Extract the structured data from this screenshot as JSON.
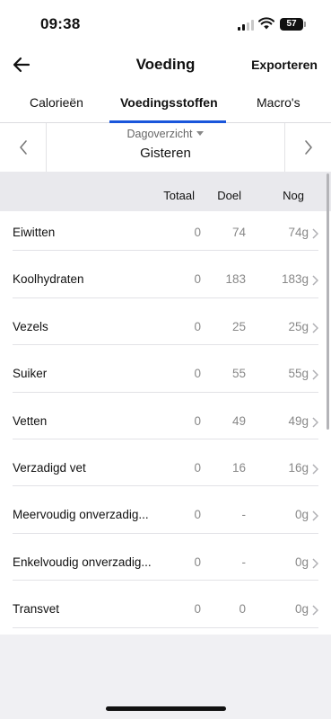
{
  "status_bar": {
    "time": "09:38",
    "battery": "57"
  },
  "nav": {
    "title": "Voeding",
    "export_label": "Exporteren"
  },
  "tabs": [
    {
      "label": "Calorieën"
    },
    {
      "label": "Voedingsstoffen"
    },
    {
      "label": "Macro's"
    }
  ],
  "day_nav": {
    "label": "Dagoverzicht",
    "value": "Gisteren"
  },
  "table": {
    "headers": [
      "Totaal",
      "Doel",
      "Nog"
    ],
    "rows": [
      {
        "name": "Eiwitten",
        "totaal": "0",
        "doel": "74",
        "nog": "74g"
      },
      {
        "name": "Koolhydraten",
        "totaal": "0",
        "doel": "183",
        "nog": "183g"
      },
      {
        "name": "Vezels",
        "totaal": "0",
        "doel": "25",
        "nog": "25g"
      },
      {
        "name": "Suiker",
        "totaal": "0",
        "doel": "55",
        "nog": "55g"
      },
      {
        "name": "Vetten",
        "totaal": "0",
        "doel": "49",
        "nog": "49g"
      },
      {
        "name": "Verzadigd vet",
        "totaal": "0",
        "doel": "16",
        "nog": "16g"
      },
      {
        "name": "Meervoudig onverzadig...",
        "totaal": "0",
        "doel": "-",
        "nog": "0g"
      },
      {
        "name": "Enkelvoudig onverzadig...",
        "totaal": "0",
        "doel": "-",
        "nog": "0g"
      },
      {
        "name": "Transvet",
        "totaal": "0",
        "doel": "0",
        "nog": "0g"
      }
    ]
  },
  "icons": {
    "back": "arrow-left-icon",
    "prev": "chevron-left-icon",
    "next": "chevron-right-icon",
    "row": "chevron-right-icon",
    "dropdown": "caret-down-icon"
  },
  "colors": {
    "accent": "#1a56db",
    "muted_text": "#888888",
    "header_bg": "#e9e9ed"
  }
}
